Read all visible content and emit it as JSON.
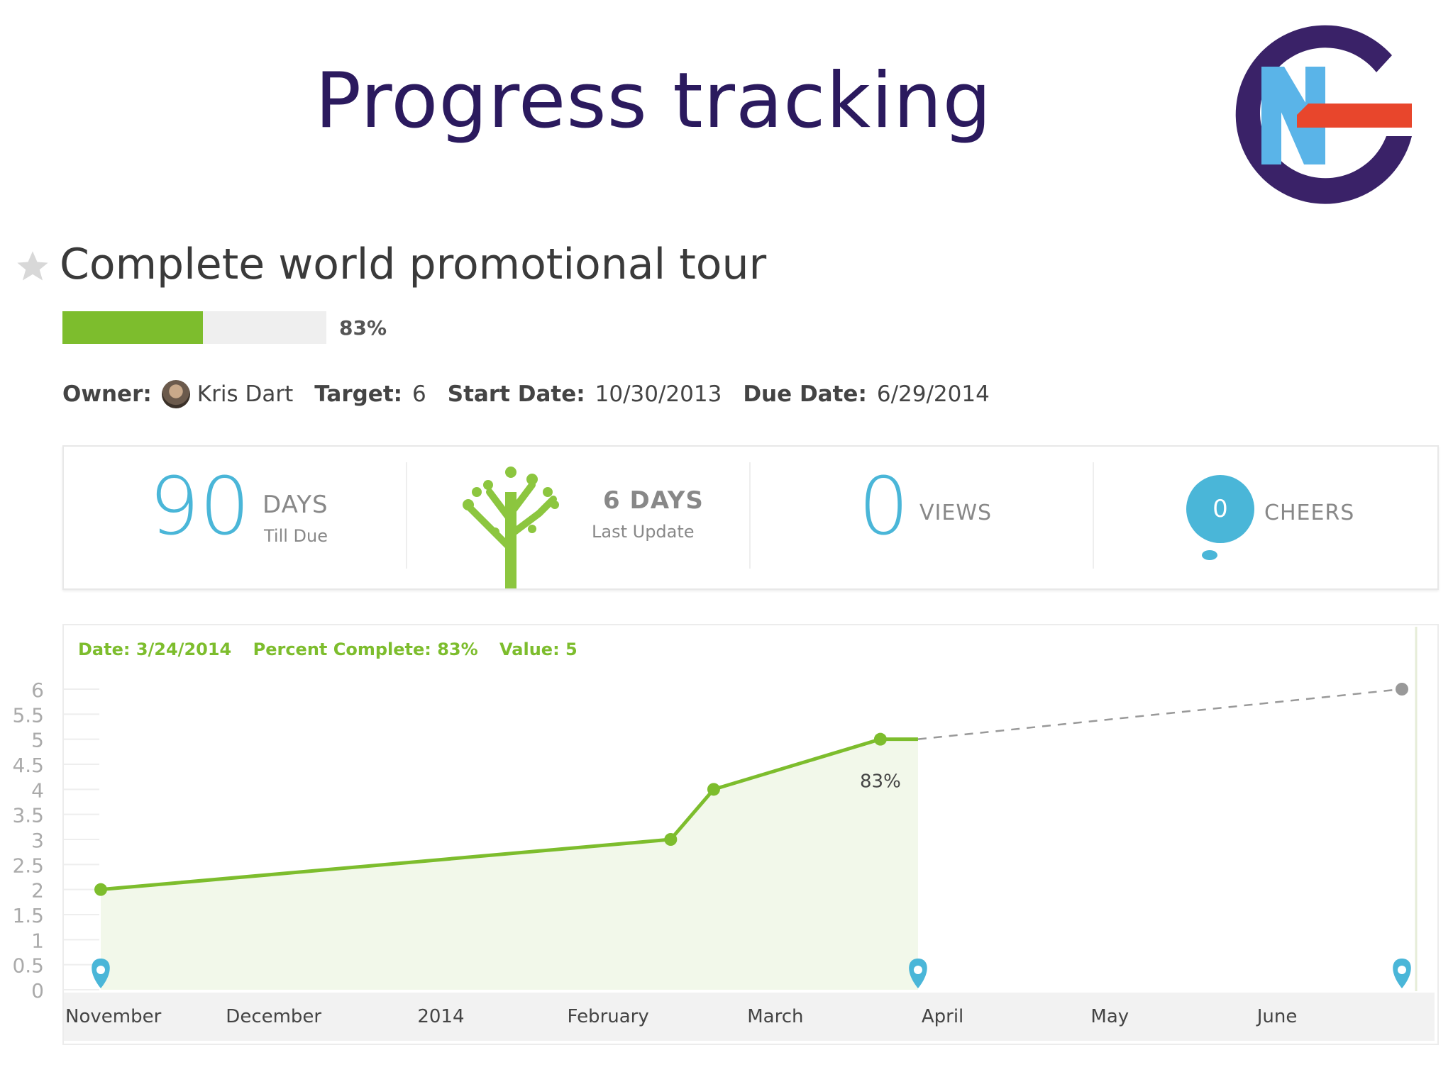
{
  "slide": {
    "title": "Progress tracking",
    "logo_colors": {
      "ring": "#3a2268",
      "blue": "#5ab4e8",
      "red": "#e8462c"
    }
  },
  "goal": {
    "title": "Complete world promotional tour",
    "progress_fraction": 0.83,
    "progress_label": "83%",
    "owner_label": "Owner:",
    "owner_name": "Kris Dart",
    "target_label": "Target:",
    "target_value": "6",
    "start_label": "Start Date:",
    "start_value": "10/30/2013",
    "due_label": "Due Date:",
    "due_value": "6/29/2014"
  },
  "stats": {
    "days_till_due": {
      "value": "90",
      "label": "DAYS",
      "sub": "Till Due"
    },
    "last_update": {
      "label": "6 DAYS",
      "sub": "Last Update"
    },
    "views": {
      "value": "0",
      "label": "VIEWS"
    },
    "cheers": {
      "value": "0",
      "label": "CHEERS"
    }
  },
  "chart_hint": {
    "date": "Date: 3/24/2014",
    "percent": "Percent Complete: 83%",
    "value": "Value: 5"
  },
  "colors": {
    "accent_green": "#7dbd2d",
    "accent_blue": "#4ab6d8",
    "projection_gray": "#999999"
  },
  "chart_data": {
    "type": "line",
    "x_tick_labels": [
      "November",
      "December",
      "2014",
      "February",
      "March",
      "April",
      "May",
      "June"
    ],
    "y_tick_labels": [
      "0",
      "0.5",
      "1",
      "1.5",
      "2",
      "2.5",
      "3",
      "3.5",
      "4",
      "4.5",
      "5",
      "5.5",
      "6"
    ],
    "ylim": [
      0,
      6
    ],
    "xlim": [
      "2013-10-30",
      "2014-06-29"
    ],
    "series": [
      {
        "kind": "actual",
        "x": [
          "2013-10-30",
          "2014-02-13",
          "2014-02-21",
          "2014-03-24",
          "2014-03-31"
        ],
        "y": [
          2,
          3,
          4,
          5,
          5
        ],
        "marker_points": [
          true,
          true,
          true,
          true,
          false
        ]
      },
      {
        "kind": "projection",
        "x": [
          "2014-03-31",
          "2014-06-29"
        ],
        "y": [
          5,
          6
        ]
      }
    ],
    "annotation": {
      "x": "2014-03-24",
      "y": 5,
      "text": "83%"
    },
    "pins_x": [
      "2013-10-30",
      "2014-03-31",
      "2014-06-29"
    ],
    "legend": "none",
    "grid": false
  }
}
